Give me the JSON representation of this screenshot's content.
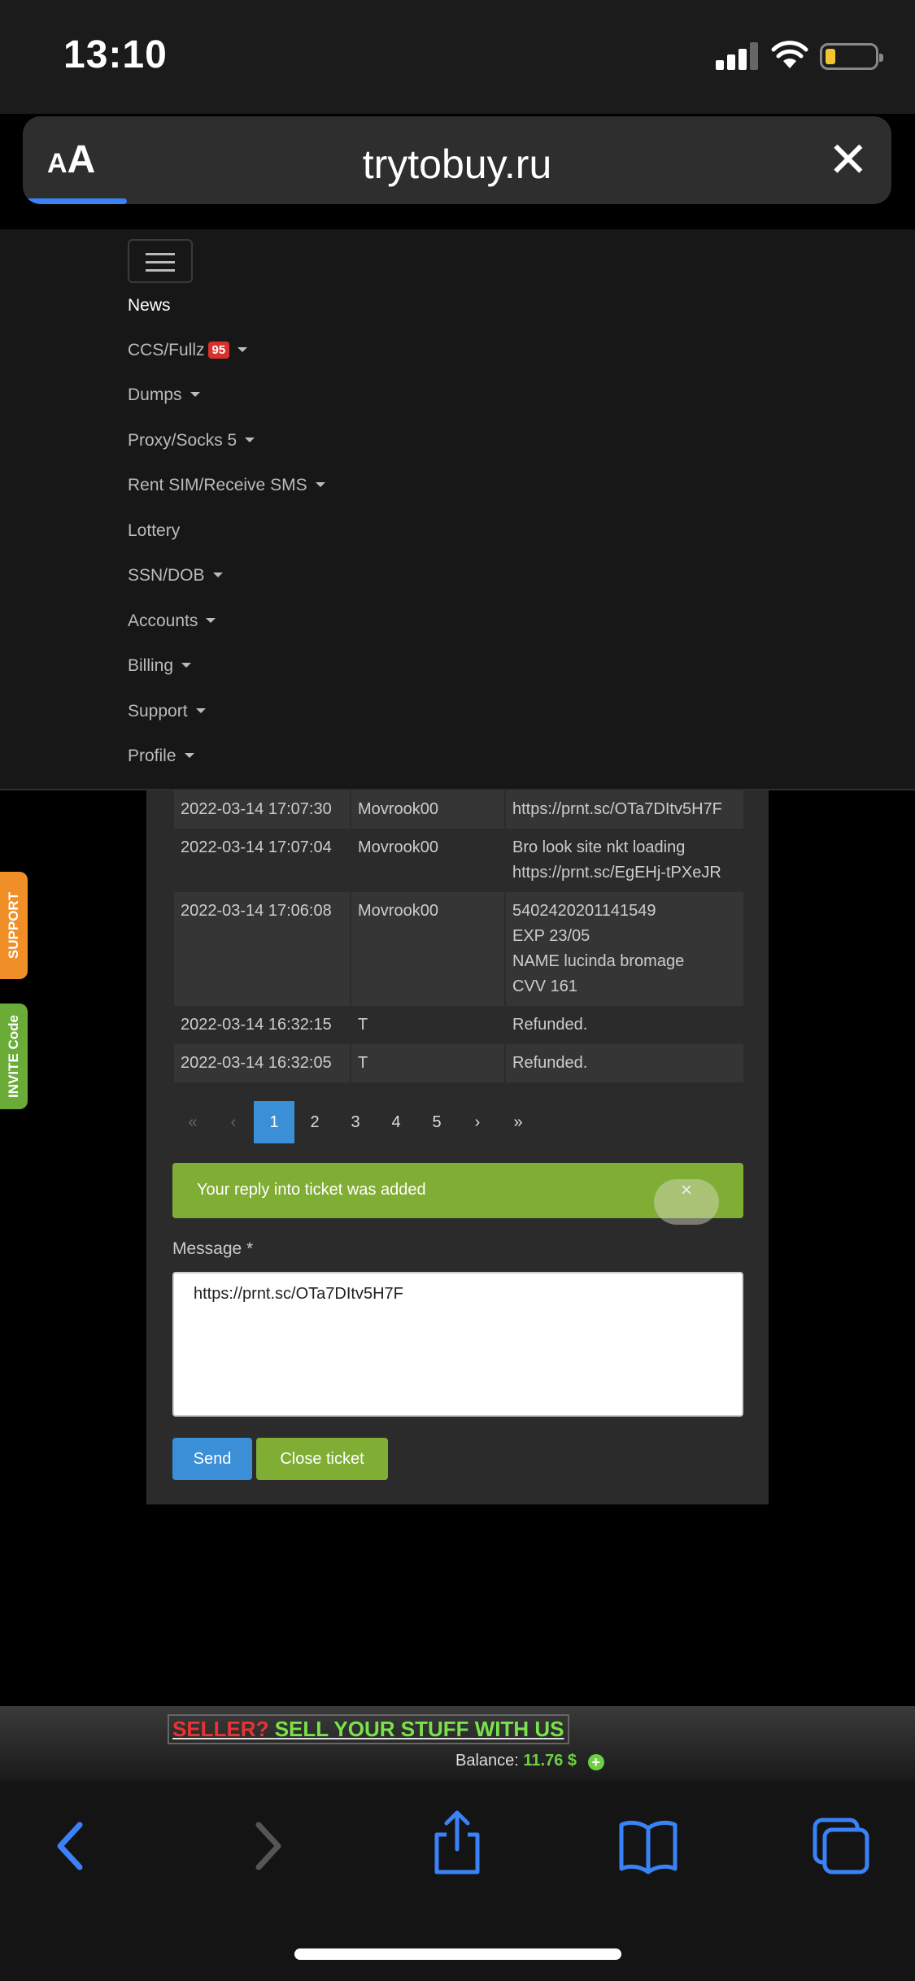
{
  "status_bar": {
    "time": "13:10"
  },
  "browser": {
    "font_size_label_small": "A",
    "font_size_label_large": "A",
    "domain": "trytobuy.ru",
    "close_label": "✕"
  },
  "nav": {
    "items": [
      {
        "label": "News",
        "dropdown": false
      },
      {
        "label": "CCS/Fullz",
        "badge": "95",
        "dropdown": true
      },
      {
        "label": "Dumps",
        "dropdown": true
      },
      {
        "label": "Proxy/Socks 5",
        "dropdown": true
      },
      {
        "label": "Rent SIM/Receive SMS",
        "dropdown": true
      },
      {
        "label": "Lottery",
        "dropdown": false
      },
      {
        "label": "SSN/DOB",
        "dropdown": true
      },
      {
        "label": "Accounts",
        "dropdown": true
      },
      {
        "label": "Billing",
        "dropdown": true
      },
      {
        "label": "Support",
        "dropdown": true
      },
      {
        "label": "Profile",
        "dropdown": true
      }
    ]
  },
  "messages": [
    {
      "date": "2022-03-14 17:07:30",
      "user": "Movrook00",
      "text": [
        "https://prnt.sc/OTa7DItv5H7F"
      ]
    },
    {
      "date": "2022-03-14 17:07:04",
      "user": "Movrook00",
      "text": [
        "Bro look site nkt loading",
        "https://prnt.sc/EgEHj-tPXeJR"
      ]
    },
    {
      "date": "2022-03-14 17:06:08",
      "user": "Movrook00",
      "text": [
        "5402420201141549",
        "EXP 23/05",
        "NAME lucinda bromage",
        "CVV 161"
      ]
    },
    {
      "date": "2022-03-14 16:32:15",
      "user": "T",
      "text": [
        "Refunded."
      ]
    },
    {
      "date": "2022-03-14 16:32:05",
      "user": "T",
      "text": [
        "Refunded."
      ]
    }
  ],
  "pagination": {
    "first": "«",
    "prev": "‹",
    "pages": [
      "1",
      "2",
      "3",
      "4",
      "5"
    ],
    "current": "1",
    "next": "›",
    "last": "»"
  },
  "alert": {
    "text": "Your reply into ticket was added",
    "close": "×"
  },
  "form": {
    "label": "Message *",
    "value": "https://prnt.sc/OTa7DItv5H7F",
    "send_label": "Send",
    "close_label": "Close ticket"
  },
  "side_tabs": {
    "support": "SUPPORT",
    "invite": "INVITE Code"
  },
  "banner": {
    "promo_red": "SELLER?",
    "promo_green": "SELL YOUR STUFF WITH US",
    "balance_label": "Balance:",
    "balance_value": "11.76 $",
    "plus": "+"
  },
  "colors": {
    "accent_blue": "#3b8fd6",
    "success_green": "#80ad34",
    "badge_red": "#d9302b",
    "safari_blue": "#3a82f7"
  }
}
